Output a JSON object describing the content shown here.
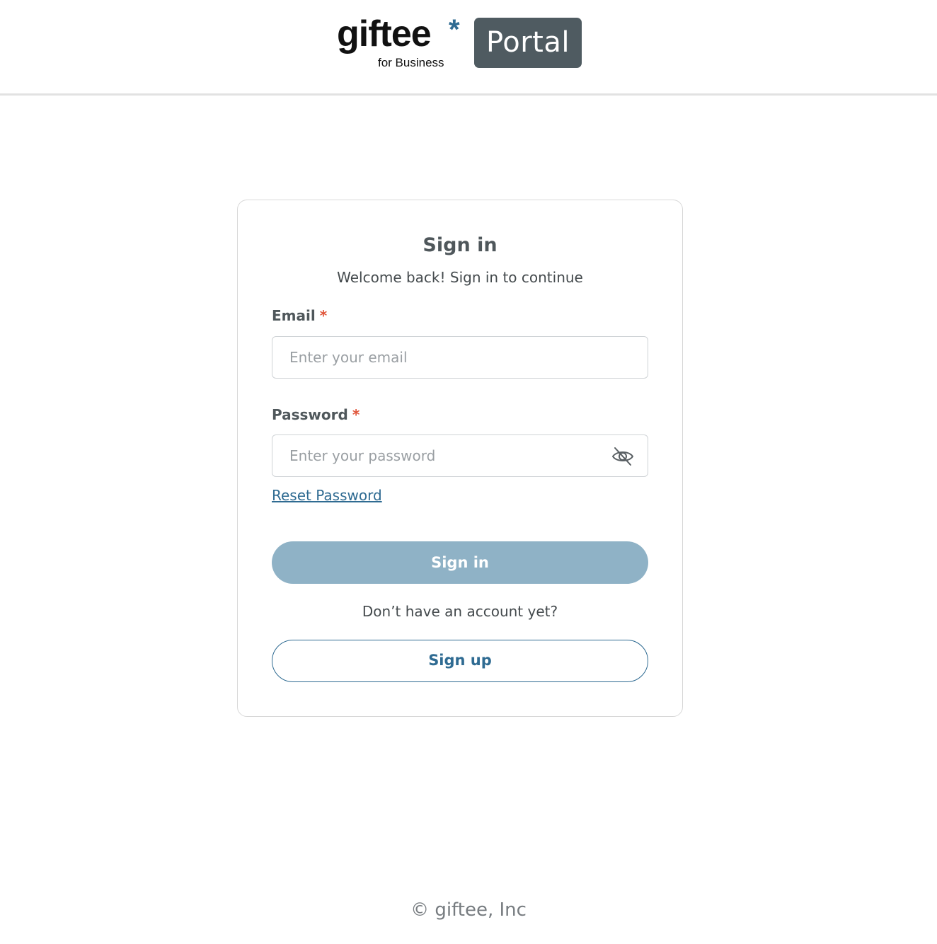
{
  "header": {
    "logo_word": "giftee",
    "logo_star": "*",
    "logo_sub": "for Business",
    "portal_label": "Portal"
  },
  "signin_card": {
    "title": "Sign in",
    "subtitle": "Welcome back! Sign in to continue",
    "email": {
      "label": "Email",
      "required_mark": "*",
      "placeholder": "Enter your email",
      "value": ""
    },
    "password": {
      "label": "Password",
      "required_mark": "*",
      "placeholder": "Enter your password",
      "value": "",
      "visibility_icon": "eye-slash-icon"
    },
    "reset_link": "Reset Password",
    "signin_button": "Sign in",
    "no_account_text": "Don’t have an account yet?",
    "signup_button": "Sign up"
  },
  "footer": {
    "copyright": "© giftee, Inc"
  },
  "colors": {
    "accent": "#2f6b92",
    "signin_button_bg": "#8fb2c6",
    "portal_badge_bg": "#4f5b61",
    "required_mark": "#e0553a"
  }
}
